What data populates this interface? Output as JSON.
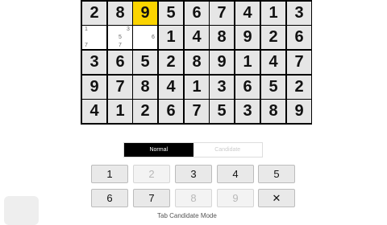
{
  "board": {
    "rows": [
      [
        "2",
        "8",
        "9",
        "5",
        "6",
        "7",
        "4",
        "1",
        "3"
      ],
      [
        "",
        "",
        "",
        "1",
        "4",
        "8",
        "9",
        "2",
        "6"
      ],
      [
        "3",
        "6",
        "5",
        "2",
        "8",
        "9",
        "1",
        "4",
        "7"
      ],
      [
        "9",
        "7",
        "8",
        "4",
        "1",
        "3",
        "6",
        "5",
        "2"
      ],
      [
        "4",
        "1",
        "2",
        "6",
        "7",
        "5",
        "3",
        "8",
        "9"
      ]
    ],
    "candidates": {
      "r1c0": [
        "1",
        "",
        "",
        "",
        "",
        "",
        "7",
        "",
        ""
      ],
      "r1c1": [
        "",
        "",
        "3",
        "",
        "5",
        "",
        "",
        "7",
        ""
      ],
      "r1c2": [
        "",
        "",
        "",
        "",
        "",
        "6",
        "",
        "",
        ""
      ]
    },
    "selected_cell": "r0c2"
  },
  "modes": {
    "normal": "Normal",
    "candidate": "Candidate",
    "active": "normal"
  },
  "keypad": {
    "row1": [
      "1",
      "2",
      "3",
      "4",
      "5"
    ],
    "row2": [
      "6",
      "7",
      "8",
      "9",
      "✕"
    ],
    "disabled": [
      "2",
      "8",
      "9"
    ]
  },
  "bottom_text": "Tab     Candidate Mode",
  "colors": {
    "selected": "#fbd400",
    "shade": "#e6e6e6",
    "active_mode": "#000000"
  }
}
